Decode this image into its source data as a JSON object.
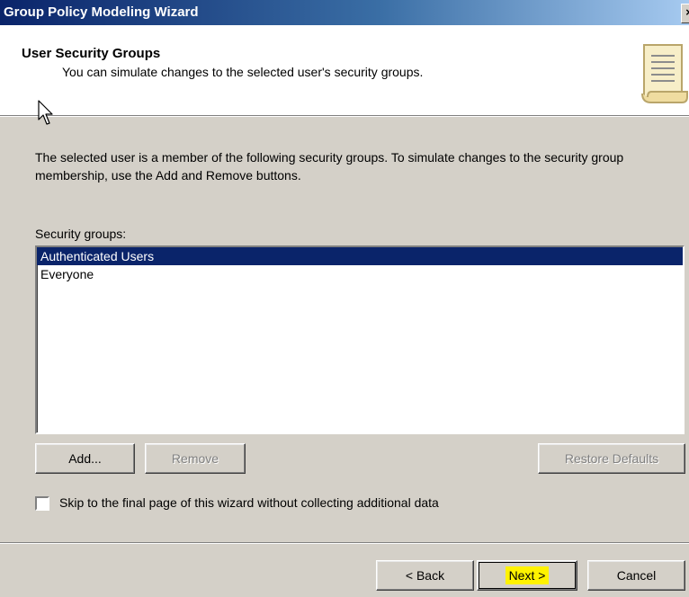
{
  "window": {
    "title": "Group Policy Modeling Wizard",
    "close_glyph": "×"
  },
  "header": {
    "title": "User Security Groups",
    "subtitle": "You can simulate changes to the selected user's security groups.",
    "icon": "scroll-icon"
  },
  "body": {
    "description": "The selected user is a member of the following security groups. To simulate changes to the security group membership, use the Add and Remove buttons.",
    "groups_label": "Security groups:",
    "groups": [
      {
        "label": "Authenticated Users",
        "selected": true
      },
      {
        "label": "Everyone",
        "selected": false
      }
    ]
  },
  "buttons": {
    "add": "Add...",
    "remove": "Remove",
    "restore_defaults": "Restore Defaults"
  },
  "skip_checkbox": {
    "label": "Skip to the final page of this wizard without collecting additional data",
    "checked": false
  },
  "footer": {
    "back": "< Back",
    "next": "Next >",
    "cancel": "Cancel"
  },
  "colors": {
    "selection": "#0a246a",
    "highlight": "#fff200",
    "dialog_bg": "#d4d0c8"
  }
}
